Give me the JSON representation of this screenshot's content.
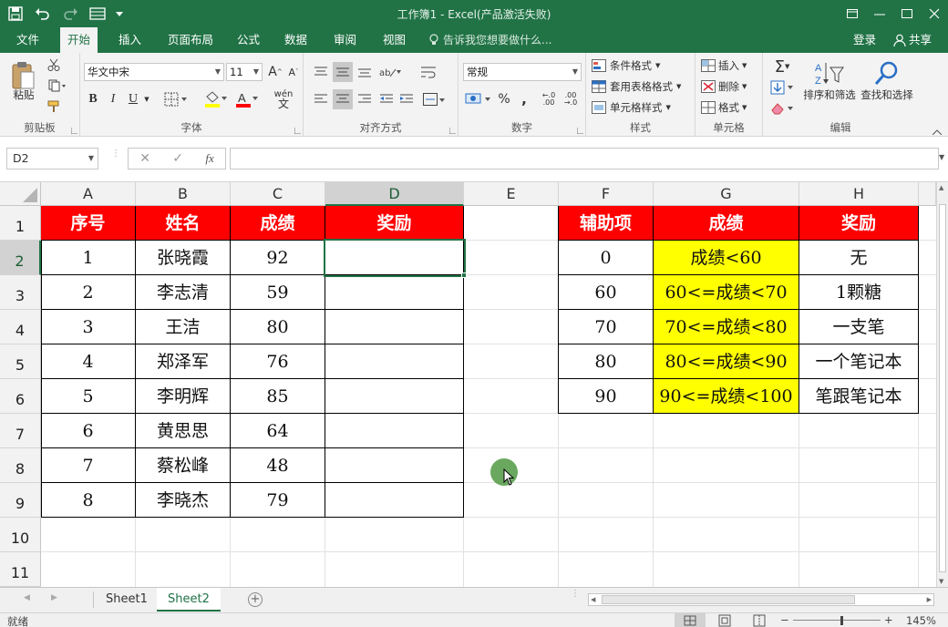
{
  "window": {
    "title": "工作簿1 - Excel(产品激活失败)"
  },
  "tabs": {
    "file": "文件",
    "home": "开始",
    "insert": "插入",
    "layout": "页面布局",
    "formulas": "公式",
    "data": "数据",
    "review": "审阅",
    "view": "视图"
  },
  "tellme": "告诉我您想要做什么...",
  "account": {
    "login": "登录",
    "share": "共享"
  },
  "ribbon": {
    "clipboard": {
      "paste": "粘贴",
      "label": "剪贴板"
    },
    "font": {
      "name": "华文中宋",
      "size": "11",
      "bold": "B",
      "italic": "I",
      "underline": "U",
      "font_color": "A",
      "wen": "wén",
      "label": "字体"
    },
    "align": {
      "label": "对齐方式"
    },
    "number": {
      "format": "常规",
      "percent": "%",
      "comma": ",",
      "label": "数字"
    },
    "styles": {
      "cond": "条件格式",
      "table": "套用表格格式",
      "cell": "单元格样式",
      "label": "样式"
    },
    "cells": {
      "insert": "插入",
      "delete": "删除",
      "format": "格式",
      "label": "单元格"
    },
    "editing": {
      "sort": "排序和筛选",
      "find": "查找和选择",
      "label": "编辑"
    }
  },
  "formula_bar": {
    "name_box": "D2",
    "fx": "fx",
    "value": ""
  },
  "columns": [
    "A",
    "B",
    "C",
    "D",
    "E",
    "F",
    "G",
    "H"
  ],
  "rows": [
    "1",
    "2",
    "3",
    "4",
    "5",
    "6",
    "7",
    "8",
    "9",
    "10",
    "11"
  ],
  "table1": {
    "headers": [
      "序号",
      "姓名",
      "成绩",
      "奖励"
    ],
    "rows": [
      [
        "1",
        "张晓霞",
        "92",
        ""
      ],
      [
        "2",
        "李志清",
        "59",
        ""
      ],
      [
        "3",
        "王洁",
        "80",
        ""
      ],
      [
        "4",
        "郑泽军",
        "76",
        ""
      ],
      [
        "5",
        "李明辉",
        "85",
        ""
      ],
      [
        "6",
        "黄思思",
        "64",
        ""
      ],
      [
        "7",
        "蔡松峰",
        "48",
        ""
      ],
      [
        "8",
        "李晓杰",
        "79",
        ""
      ]
    ]
  },
  "table2": {
    "headers": [
      "辅助项",
      "成绩",
      "奖励"
    ],
    "rows": [
      [
        "0",
        "成绩<60",
        "无"
      ],
      [
        "60",
        "60<=成绩<70",
        "1颗糖"
      ],
      [
        "70",
        "70<=成绩<80",
        "一支笔"
      ],
      [
        "80",
        "80<=成绩<90",
        "一个笔记本"
      ],
      [
        "90",
        "90<=成绩<100",
        "笔跟笔记本"
      ]
    ]
  },
  "sheets": [
    "Sheet1",
    "Sheet2"
  ],
  "status": {
    "ready": "就绪",
    "zoom": "145%"
  },
  "colors": {
    "excel_green": "#217346",
    "header_red": "#ff0000",
    "highlight_yellow": "#ffff00"
  }
}
